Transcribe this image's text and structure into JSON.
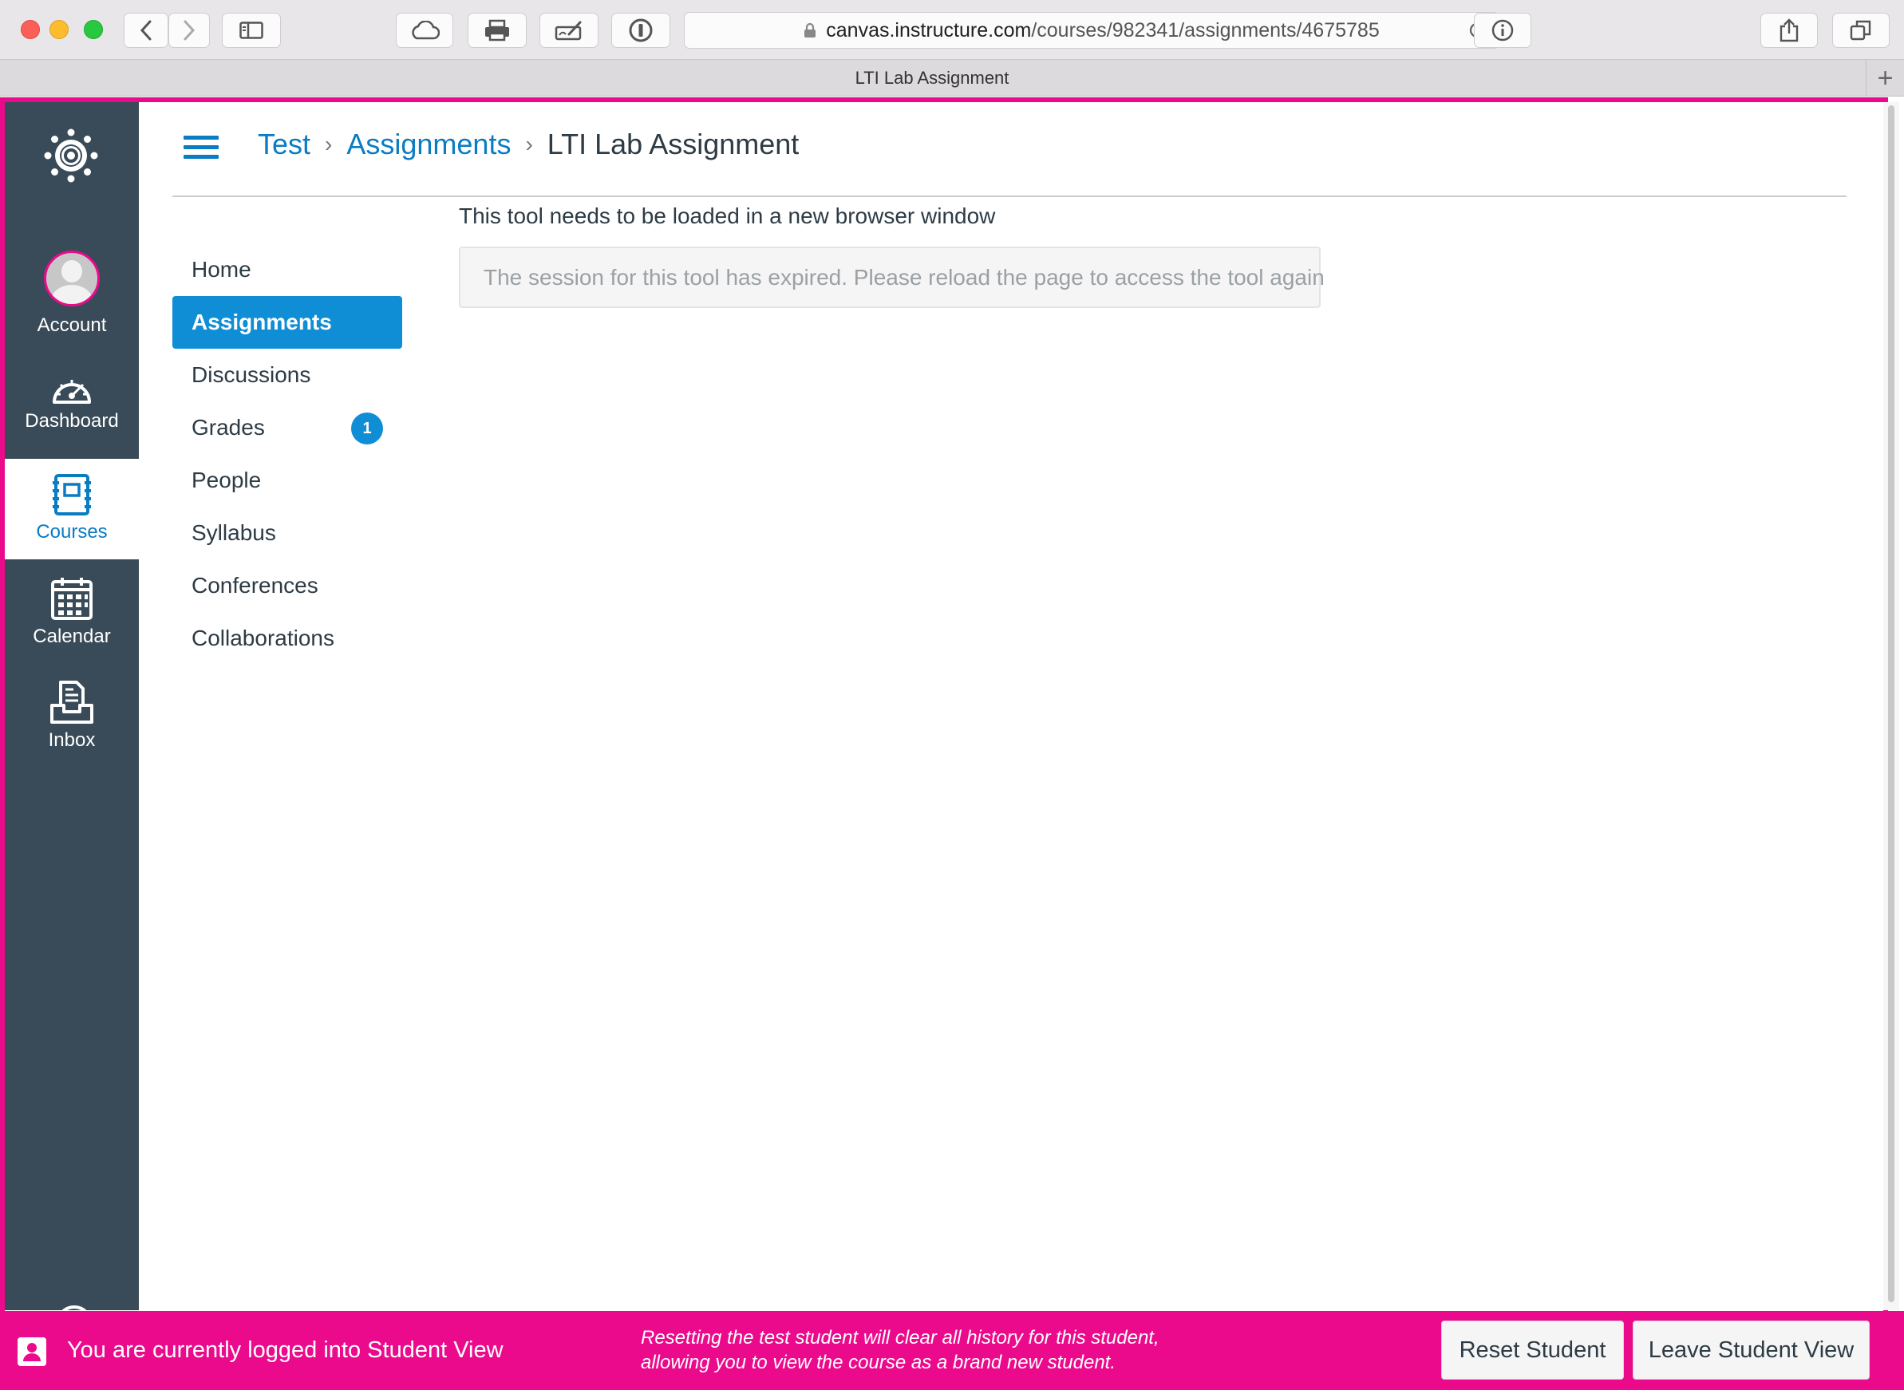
{
  "browser": {
    "url_host": "canvas.instructure.com",
    "url_path": "/courses/982341/assignments/4675785",
    "tab_title": "LTI Lab Assignment",
    "new_tab_symbol": "+"
  },
  "global_nav": {
    "items": [
      {
        "label": "Account",
        "icon": "user-avatar-icon"
      },
      {
        "label": "Dashboard",
        "icon": "dashboard-gauge-icon"
      },
      {
        "label": "Courses",
        "icon": "courses-book-icon",
        "active": true
      },
      {
        "label": "Calendar",
        "icon": "calendar-icon"
      },
      {
        "label": "Inbox",
        "icon": "inbox-icon"
      }
    ]
  },
  "breadcrumbs": {
    "course": "Test",
    "section": "Assignments",
    "current": "LTI Lab Assignment",
    "separator": "›"
  },
  "course_nav": {
    "items": [
      {
        "label": "Home"
      },
      {
        "label": "Assignments",
        "active": true
      },
      {
        "label": "Discussions"
      },
      {
        "label": "Grades",
        "badge": "1"
      },
      {
        "label": "People"
      },
      {
        "label": "Syllabus"
      },
      {
        "label": "Conferences"
      },
      {
        "label": "Collaborations"
      }
    ]
  },
  "main": {
    "tool_heading": "This tool needs to be loaded in a new browser window",
    "session_message": "The session for this tool has expired. Please reload the page to access the tool again"
  },
  "student_view": {
    "title": "You are currently logged into Student View",
    "note": "Resetting the test student will clear all history for this student, allowing you to view the course as a brand new student.",
    "reset_label": "Reset Student",
    "leave_label": "Leave Student View"
  },
  "colors": {
    "brand_pink": "#ec0a8c",
    "link_blue": "#0a7cc2",
    "active_blue": "#0f8ed6",
    "nav_dark": "#394b58"
  }
}
